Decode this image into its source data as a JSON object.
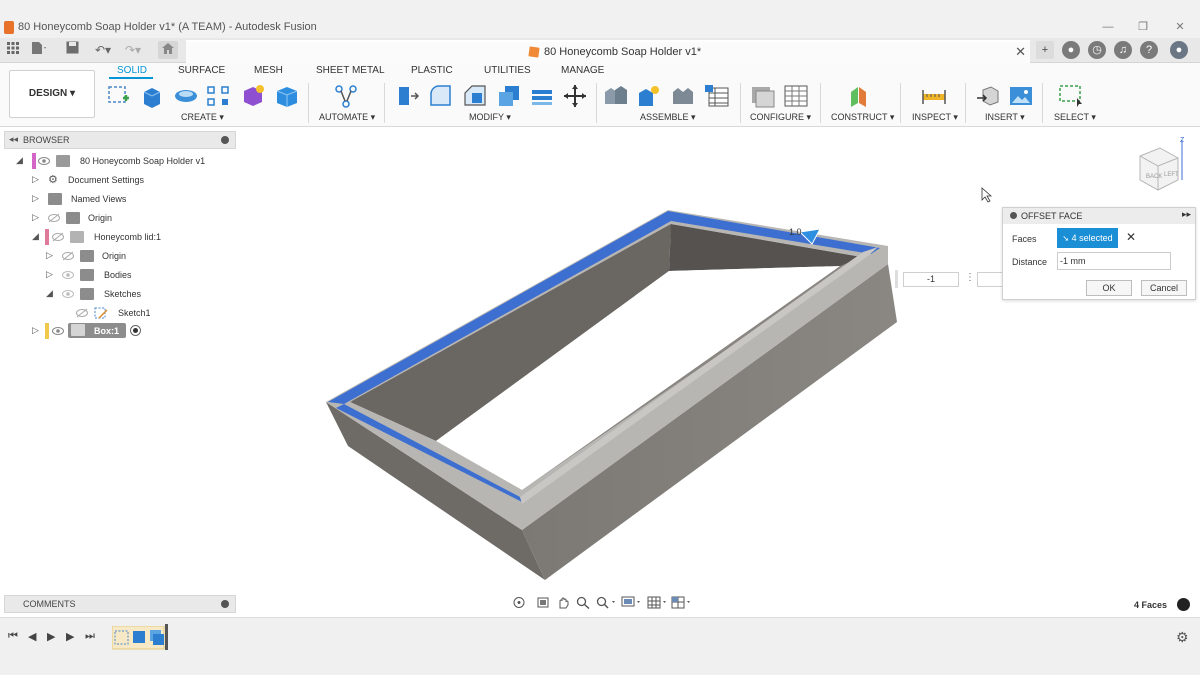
{
  "window": {
    "title": "80 Honeycomb Soap Holder v1* (A TEAM) - Autodesk Fusion",
    "controls": [
      "—",
      "❐",
      "✕"
    ]
  },
  "document_tab": {
    "label": "80 Honeycomb Soap Holder v1*",
    "close": "✕"
  },
  "workspace": {
    "label": "DESIGN ▾"
  },
  "ribbon": {
    "tabs": [
      "SOLID",
      "SURFACE",
      "MESH",
      "SHEET METAL",
      "PLASTIC",
      "UTILITIES",
      "MANAGE"
    ],
    "active_tab": "SOLID",
    "groups": [
      "CREATE ▾",
      "AUTOMATE ▾",
      "MODIFY ▾",
      "ASSEMBLE ▾",
      "CONFIGURE ▾",
      "CONSTRUCT ▾",
      "INSPECT ▾",
      "INSERT ▾",
      "SELECT ▾"
    ]
  },
  "browser": {
    "title": "BROWSER",
    "items": [
      {
        "label": "80 Honeycomb Soap Holder v1",
        "icon": "document-icon"
      },
      {
        "label": "Document Settings",
        "icon": "gear-icon"
      },
      {
        "label": "Named Views",
        "icon": "folder-icon"
      },
      {
        "label": "Origin",
        "icon": "folder-icon"
      },
      {
        "label": "Honeycomb lid:1",
        "icon": "component-icon"
      },
      {
        "label": "Origin",
        "icon": "folder-icon"
      },
      {
        "label": "Bodies",
        "icon": "folder-icon"
      },
      {
        "label": "Sketches",
        "icon": "folder-icon"
      },
      {
        "label": "Sketch1",
        "icon": "sketch-icon"
      },
      {
        "label": "Box:1",
        "icon": "component-icon"
      }
    ]
  },
  "comments": {
    "title": "COMMENTS"
  },
  "offset_face": {
    "title": "OFFSET FACE",
    "faces_label": "Faces",
    "faces_value": "4 selected",
    "distance_label": "Distance",
    "distance_value": "-1 mm",
    "ok": "OK",
    "cancel": "Cancel"
  },
  "canvas": {
    "manipulator_value": "-1"
  },
  "status": {
    "selection_count": "4 Faces"
  },
  "colors": {
    "accent": "#0696d7",
    "selection": "#3d6fd1",
    "body": "#7a7772"
  }
}
